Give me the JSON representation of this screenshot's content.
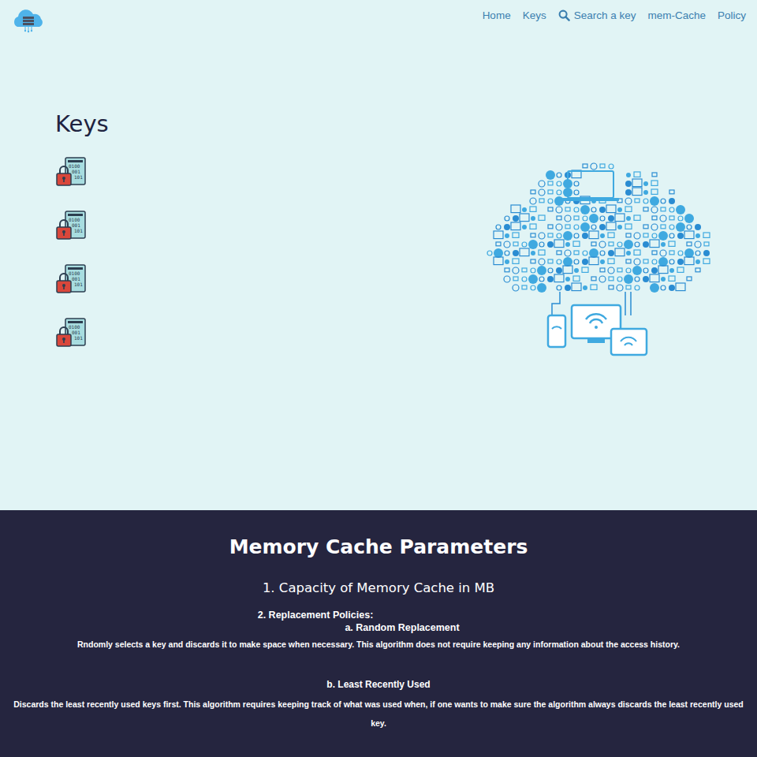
{
  "nav": {
    "items": [
      {
        "label": "Home",
        "icon": false
      },
      {
        "label": "Keys",
        "icon": false
      },
      {
        "label": "Search a key",
        "icon": true
      },
      {
        "label": "mem-Cache",
        "icon": false
      },
      {
        "label": "Policy",
        "icon": false
      }
    ]
  },
  "main": {
    "heading": "Keys",
    "key_items": [
      {
        "locked": true
      },
      {
        "locked": true
      },
      {
        "locked": true
      },
      {
        "locked": true
      }
    ]
  },
  "parameters": {
    "title": "Memory Cache Parameters",
    "capacity": "1. Capacity of Memory Cache in MB",
    "policies_heading": "2. Replacement Policies:",
    "policies": [
      {
        "name": "a. Random Replacement",
        "description": "Rndomly selects a key and discards it to make space when necessary. This algorithm does not require keeping any information about the access history."
      },
      {
        "name": "b. Least Recently Used",
        "description": "Discards the least recently used keys first. This algorithm requires keeping track of what was used when, if one wants to make sure the algorithm always discards the least recently used key."
      }
    ]
  }
}
